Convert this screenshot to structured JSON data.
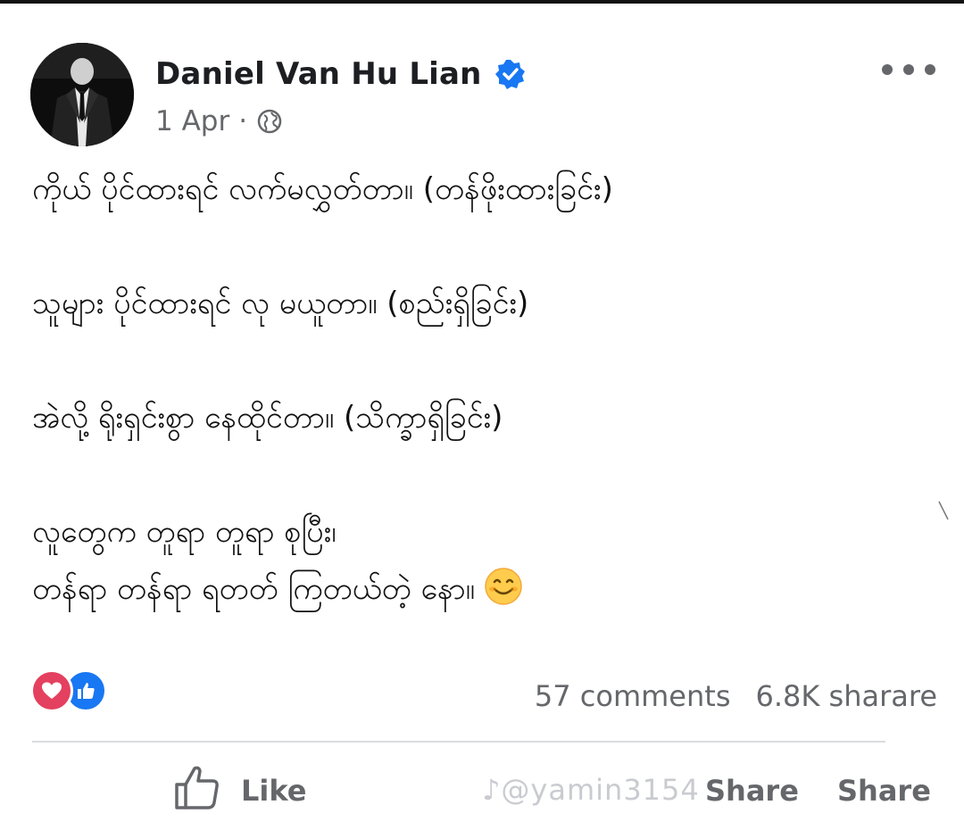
{
  "post": {
    "author": "Daniel Van Hu Lian",
    "date": "1 Apr",
    "separator": "·",
    "icons": {
      "verified": "verified-badge-icon",
      "audience": "globe-icon",
      "more": "more-options-icon",
      "reaction_love": "love-reaction-icon",
      "reaction_like": "like-reaction-icon",
      "like_action": "thumbs-up-icon"
    },
    "lines": [
      "ကိုယ် ပိုင်ထားရင် လက်မလွှတ်တာ။ (တန်ဖိုးထားခြင်း)",
      "သူများ ပိုင်ထားရင် လု မယူတာ။ (စည်းရှိခြင်း)",
      "အဲလို့ ရိုးရှင်းစွာ နေထိုင်တာ။ (သိက္ခာရှိခြင်း)",
      "လူတွေက တူရာ တူရာ စုပြီး၊",
      "တန်ရာ တန်ရာ ရတတ် ကြတယ်တဲ့ နော။"
    ]
  },
  "stats": {
    "comments": "57 comments",
    "shares": "6.8K sharare"
  },
  "actions": {
    "like": "Like",
    "share": "Share",
    "share2": "Share"
  },
  "watermark": "♪@yamin3154",
  "colors": {
    "brand_blue": "#1877f2",
    "love_red": "#e4405f",
    "muted": "#65676b"
  }
}
